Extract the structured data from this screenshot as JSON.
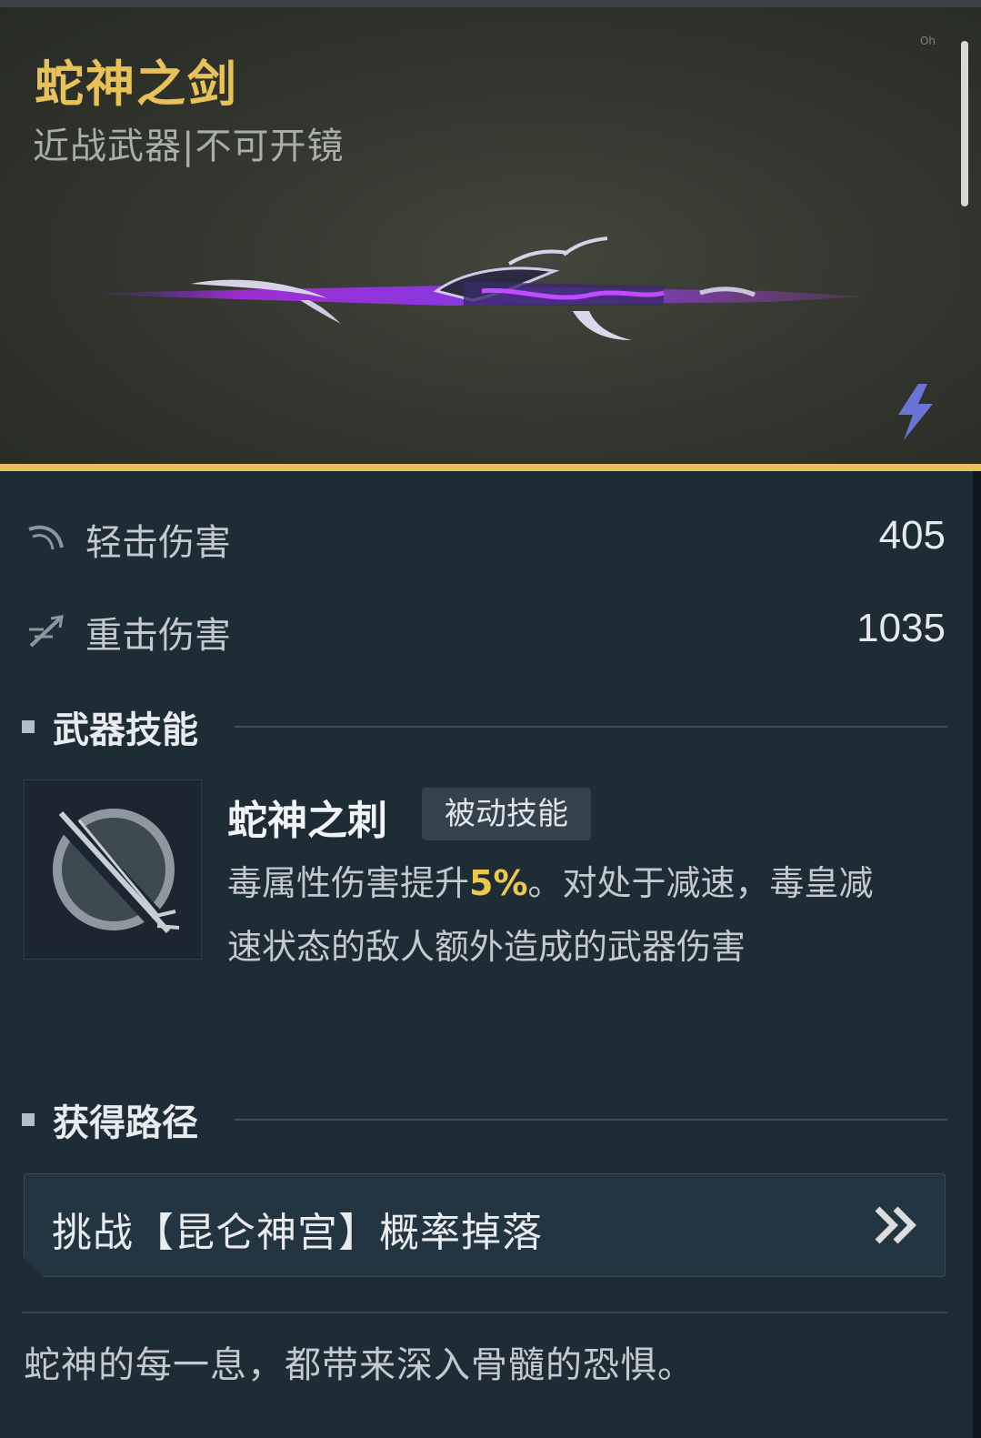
{
  "weapon": {
    "name": "蛇神之剑",
    "type_line": "近战武器|不可开镜",
    "corner_text": "Oh"
  },
  "stats": [
    {
      "label": "轻击伤害",
      "value": "405",
      "icon": "light-attack-icon"
    },
    {
      "label": "重击伤害",
      "value": "1035",
      "icon": "heavy-attack-icon"
    }
  ],
  "skill_section": {
    "heading": "武器技能",
    "skill_name": "蛇神之刺",
    "badge": "被动技能",
    "desc_before": "毒属性伤害提升",
    "desc_highlight": "5%",
    "desc_after": "。对处于减速，毒皇减速状态的敌人额外造成的武器伤害",
    "icon": "serpent-spear-icon"
  },
  "source_section": {
    "heading": "获得路径",
    "button_text": "挑战【昆仑神宫】概率掉落",
    "button_icon": "double-chevron-right-icon"
  },
  "flavor_text": "蛇神的每一息，都带来深入骨髓的恐惧。",
  "colors": {
    "title_gold": "#e9c257",
    "accent_line": "#e7c25c",
    "highlight": "#ecc94b",
    "panel_bg": "#1e2c36"
  }
}
